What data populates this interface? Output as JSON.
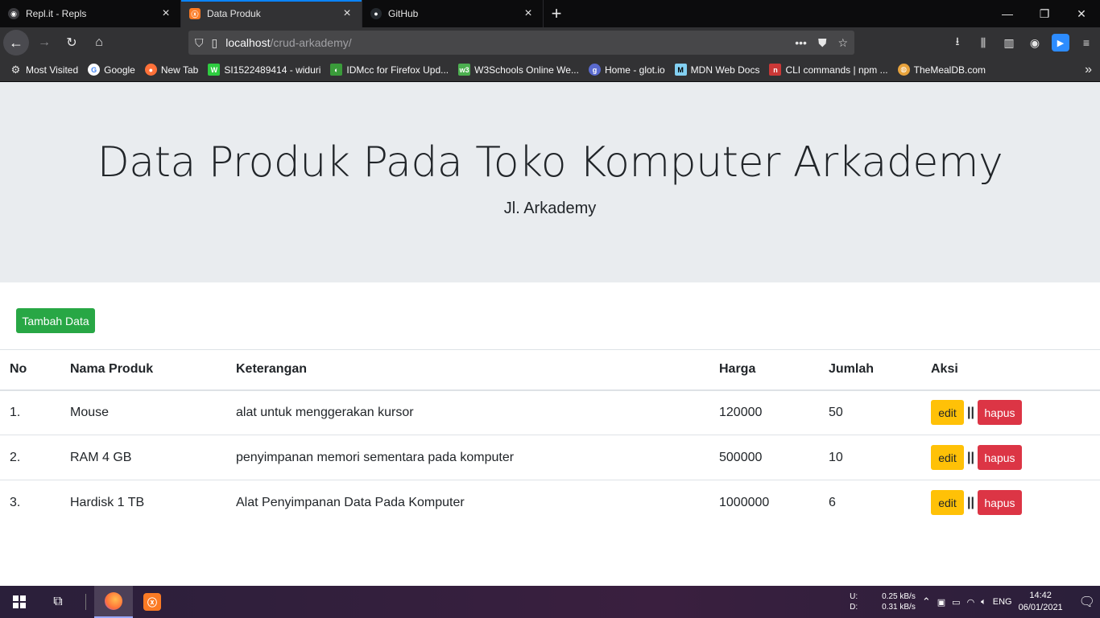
{
  "browser": {
    "tabs": [
      {
        "title": "Repl.it - Repls",
        "active": false,
        "icon": "replit-icon"
      },
      {
        "title": "Data Produk",
        "active": true,
        "icon": "xampp-icon"
      },
      {
        "title": "GitHub",
        "active": false,
        "icon": "github-icon"
      }
    ],
    "url_host": "localhost",
    "url_path": "/crud-arkademy/",
    "bookmarks": [
      {
        "label": "Most Visited",
        "icon": "gear-icon",
        "color": "#4a4a4f"
      },
      {
        "label": "Google",
        "icon": "google-icon",
        "color": "#4285f4"
      },
      {
        "label": "New Tab",
        "icon": "firefox-icon",
        "color": "#ff7139"
      },
      {
        "label": "SI1522489414 - widuri",
        "icon": "widuri-icon",
        "color": "#2ecc40"
      },
      {
        "label": "IDMcc for Firefox Upd...",
        "icon": "idm-icon",
        "color": "#3a9b3a"
      },
      {
        "label": "W3Schools Online We...",
        "icon": "w3schools-icon",
        "color": "#4caf50"
      },
      {
        "label": "Home - glot.io",
        "icon": "glot-icon",
        "color": "#5a6acf"
      },
      {
        "label": "MDN Web Docs",
        "icon": "mdn-icon",
        "color": "#83d0f2"
      },
      {
        "label": "CLI commands | npm ...",
        "icon": "npm-icon",
        "color": "#cb3837"
      },
      {
        "label": "TheMealDB.com",
        "icon": "mealdb-icon",
        "color": "#e8a33c"
      }
    ]
  },
  "page": {
    "title": "Data Produk Pada Toko Komputer Arkademy",
    "subtitle": "Jl. Arkademy",
    "add_button": "Tambah Data",
    "table": {
      "headers": [
        "No",
        "Nama Produk",
        "Keterangan",
        "Harga",
        "Jumlah",
        "Aksi"
      ],
      "rows": [
        {
          "no": "1.",
          "nama": "Mouse",
          "keterangan": "alat untuk menggerakan kursor",
          "harga": "120000",
          "jumlah": "50"
        },
        {
          "no": "2.",
          "nama": "RAM 4 GB",
          "keterangan": "penyimpanan memori sementara pada komputer",
          "harga": "500000",
          "jumlah": "10"
        },
        {
          "no": "3.",
          "nama": "Hardisk 1 TB",
          "keterangan": "Alat Penyimpanan Data Pada Komputer",
          "harga": "1000000",
          "jumlah": "6"
        }
      ],
      "edit_label": "edit",
      "separator": "||",
      "delete_label": "hapus"
    }
  },
  "taskbar": {
    "net_up_label": "U:",
    "net_down_label": "D:",
    "net_up": "0.25 kB/s",
    "net_down": "0.31 kB/s",
    "language": "ENG",
    "time": "14:42",
    "date": "06/01/2021"
  },
  "colors": {
    "success": "#28a745",
    "warning": "#ffc107",
    "danger": "#dc3545",
    "jumbotron": "#e9ecef"
  }
}
